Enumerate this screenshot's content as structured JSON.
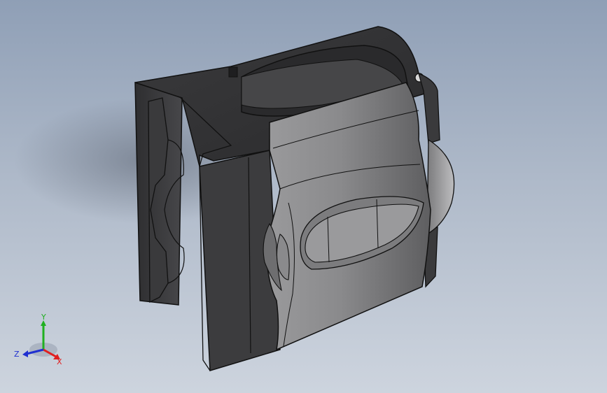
{
  "viewport": {
    "background_top": "#8f9fb6",
    "background_bottom": "#cdd4de"
  },
  "model": {
    "housing_color": "#3e3e40",
    "face_color": "#8a8a8c",
    "edge_color": "#111111"
  },
  "triad": {
    "x_label": "X",
    "y_label": "Y",
    "z_label": "Z",
    "x_color": "#e02020",
    "y_color": "#20b020",
    "z_color": "#2030d0"
  }
}
